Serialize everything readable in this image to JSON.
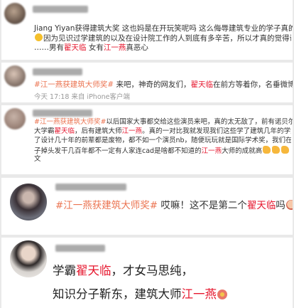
{
  "comment1": {
    "line1_prefix": "Jiang Yiyan获得建筑大奖 这也妈是在开玩笑呢吗 这么侮辱建筑专业的学子真的好吗",
    "line2": "因为见识过学建筑的以及在设计院工作的人到底有多辛苦，所以才真的觉得讽刺……无语了",
    "line3_prefix": "……男有",
    "line3_name1": "翟天临",
    "line3_mid": " 女有",
    "line3_name2": "江一燕",
    "line3_suffix": "真恶心"
  },
  "comment2": {
    "hashtag": "#江一燕获建筑大师奖#",
    "text_prefix": " 来吧，神奇的网友们，",
    "name": "翟天临",
    "text_suffix": "在前方等着你，名垂微博史哦~",
    "timestamp": "今天 17:18 来自 iPhone客户端"
  },
  "comment3": {
    "hashtag": "#江一燕获建筑大师奖#",
    "line1_text": "以后国家大事都交给这些演员来吧，真的太无敌了，前有诺贝尔靳东",
    "line2_prefix": "大学霸",
    "line2_name1": "翟天临",
    "line2_mid": "，后有建筑大师",
    "line2_name2": "江一燕",
    "line2_suffix": "。真的一对比我就发现我们这些学了建筑几年的学生还有干",
    "line3": "了设计几十年的前辈都是废物，都不如一个演员nb，随便玩玩就是国际学术奖，我们在这里费脑",
    "line4_prefix": "子掉头发干几百年都不一定有人家连cad是啥都不知道的",
    "line4_name": "江一燕",
    "line4_suffix": "大师的成就高",
    "line5": "文"
  },
  "comment4": {
    "hashtag": "#江一燕获建筑大师奖#",
    "text_prefix": " 哎嘛！这不是第二个",
    "name": "翟天临",
    "text_suffix": "吗"
  },
  "comment5": {
    "line1_prefix": "学霸",
    "line1_name": "翟天临",
    "line1_suffix": "，才女马思纯，",
    "line2_prefix": "知识分子靳东，建筑大师",
    "line2_name": "江一燕"
  },
  "colors": {
    "hashtag": "#eb7350",
    "highlight_name": "#e6162d",
    "background": "#e9e9e9"
  }
}
